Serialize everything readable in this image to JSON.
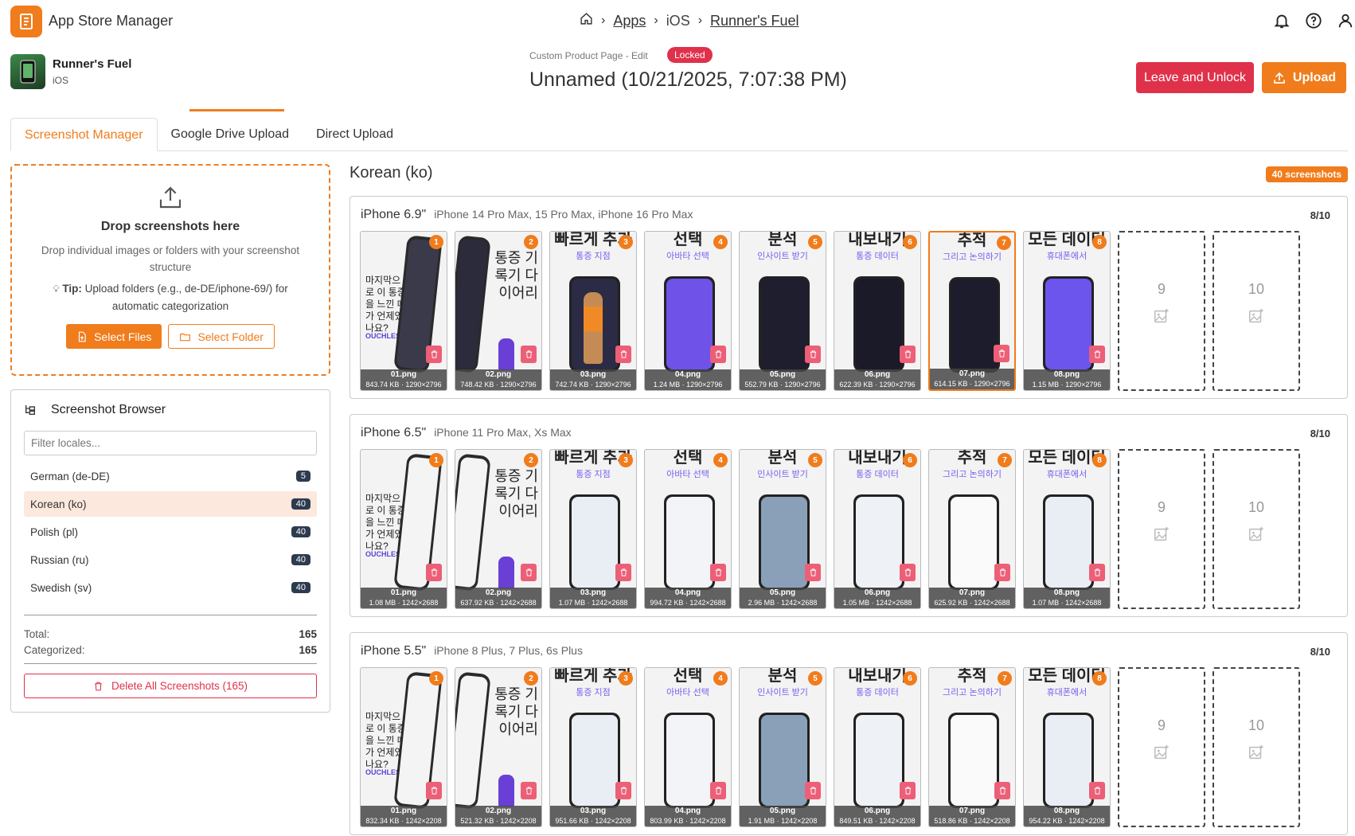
{
  "app": {
    "title": "App Store Manager"
  },
  "breadcrumb": {
    "apps": "Apps",
    "platform": "iOS",
    "product": "Runner's Fuel"
  },
  "product": {
    "name": "Runner's Fuel",
    "platform": "iOS"
  },
  "page": {
    "subtitle": "Custom Product Page - Edit",
    "badge": "Locked",
    "title": "Unnamed (10/21/2025, 7:07:38 PM)"
  },
  "actions": {
    "leave": "Leave and Unlock",
    "upload": "Upload"
  },
  "tabs": [
    {
      "label": "Screenshot Manager"
    },
    {
      "label": "Google Drive Upload"
    },
    {
      "label": "Direct Upload"
    }
  ],
  "dropzone": {
    "title": "Drop screenshots here",
    "desc": "Drop individual images or folders with your screenshot structure",
    "tip_label": "Tip:",
    "tip_text": "Upload folders (e.g., de-DE/iphone-69/) for automatic categorization",
    "select_files": "Select Files",
    "select_folder": "Select Folder"
  },
  "browser": {
    "title": "Screenshot Browser",
    "filter_placeholder": "Filter locales...",
    "locales": [
      {
        "label": "German (de-DE)",
        "count": "5"
      },
      {
        "label": "Korean (ko)",
        "count": "40"
      },
      {
        "label": "Polish (pl)",
        "count": "40"
      },
      {
        "label": "Russian (ru)",
        "count": "40"
      },
      {
        "label": "Swedish (sv)",
        "count": "40"
      }
    ],
    "total_label": "Total:",
    "total": "165",
    "categorized_label": "Categorized:",
    "categorized": "165",
    "delete_all": "Delete All Screenshots (165)"
  },
  "main": {
    "locale": "Korean (ko)",
    "count_badge": "40 screenshots",
    "devices": [
      {
        "name": "iPhone 6.9\"",
        "models": "iPhone 14 Pro Max, 15 Pro Max, iPhone 16 Pro Max",
        "count": "8/10",
        "shots": [
          {
            "num": "1",
            "file": "01.png",
            "meta": "843.74 KB · 1290×2796"
          },
          {
            "num": "2",
            "file": "02.png",
            "meta": "748.42 KB · 1290×2796"
          },
          {
            "num": "3",
            "file": "03.png",
            "meta": "742.74 KB · 1290×2796"
          },
          {
            "num": "4",
            "file": "04.png",
            "meta": "1.24 MB · 1290×2796"
          },
          {
            "num": "5",
            "file": "05.png",
            "meta": "552.79 KB · 1290×2796"
          },
          {
            "num": "6",
            "file": "06.png",
            "meta": "622.39 KB · 1290×2796"
          },
          {
            "num": "7",
            "file": "07.png",
            "meta": "614.15 KB · 1290×2796"
          },
          {
            "num": "8",
            "file": "08.png",
            "meta": "1.15 MB · 1290×2796"
          }
        ]
      },
      {
        "name": "iPhone 6.5\"",
        "models": "iPhone 11 Pro Max, Xs Max",
        "count": "8/10",
        "shots": [
          {
            "num": "1",
            "file": "01.png",
            "meta": "1.08 MB · 1242×2688"
          },
          {
            "num": "2",
            "file": "02.png",
            "meta": "637.92 KB · 1242×2688"
          },
          {
            "num": "3",
            "file": "03.png",
            "meta": "1.07 MB · 1242×2688"
          },
          {
            "num": "4",
            "file": "04.png",
            "meta": "994.72 KB · 1242×2688"
          },
          {
            "num": "5",
            "file": "05.png",
            "meta": "2.96 MB · 1242×2688"
          },
          {
            "num": "6",
            "file": "06.png",
            "meta": "1.05 MB · 1242×2688"
          },
          {
            "num": "7",
            "file": "07.png",
            "meta": "625.92 KB · 1242×2688"
          },
          {
            "num": "8",
            "file": "08.png",
            "meta": "1.07 MB · 1242×2688"
          }
        ]
      },
      {
        "name": "iPhone 5.5\"",
        "models": "iPhone 8 Plus, 7 Plus, 6s Plus",
        "count": "8/10",
        "shots": [
          {
            "num": "1",
            "file": "01.png",
            "meta": "832.34 KB · 1242×2208"
          },
          {
            "num": "2",
            "file": "02.png",
            "meta": "521.32 KB · 1242×2208"
          },
          {
            "num": "3",
            "file": "03.png",
            "meta": "951.66 KB · 1242×2208"
          },
          {
            "num": "4",
            "file": "04.png",
            "meta": "803.99 KB · 1242×2208"
          },
          {
            "num": "5",
            "file": "05.png",
            "meta": "1.91 MB · 1242×2208"
          },
          {
            "num": "6",
            "file": "06.png",
            "meta": "849.51 KB · 1242×2208"
          },
          {
            "num": "7",
            "file": "07.png",
            "meta": "518.86 KB · 1242×2208"
          },
          {
            "num": "8",
            "file": "08.png",
            "meta": "954.22 KB · 1242×2208"
          }
        ]
      }
    ],
    "empty_slots": [
      "9",
      "10"
    ],
    "art": {
      "s1_text": "마지막으로 이 통증을 느낀 때가 언제였나요?",
      "s1_brand": "OUCHLESS",
      "s2_text": "통증 기록기 다이어리",
      "s3_head": "빠르게 추가",
      "s3_sub": "통증 지점",
      "s4_head": "선택",
      "s4_sub": "아바타 선택",
      "s5_head": "분석",
      "s5_sub": "인사이트 받기",
      "s6_head": "내보내기",
      "s6_sub": "통증 데이터",
      "s7_head": "추적",
      "s7_sub": "그리고 논의하기",
      "s8_head": "모든 데이터",
      "s8_sub": "휴대폰에서"
    }
  },
  "colors": {
    "accent": "#f07c1c",
    "danger": "#e0314b",
    "badge_dark": "#2d3b4f"
  }
}
